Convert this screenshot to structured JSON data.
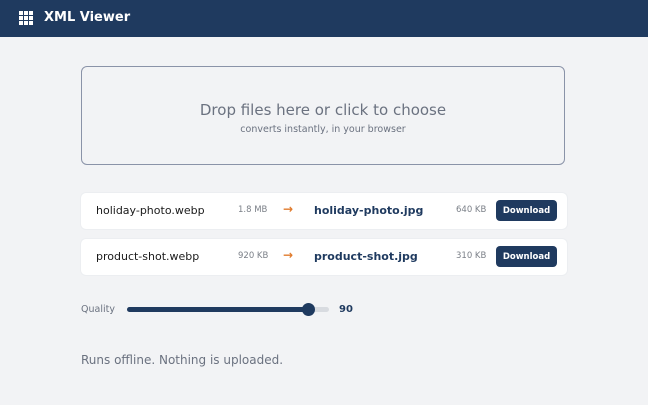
{
  "app": {
    "title": "XML Viewer",
    "icon": "grid-icon"
  },
  "dropzone": {
    "main_text": "Drop files here or click to choose",
    "sub_text": "converts instantly, in your browser"
  },
  "files": [
    {
      "source_name": "holiday-photo.webp",
      "source_size": "1.8 MB",
      "arrow": "→",
      "output_name": "holiday-photo.jpg",
      "output_size": "640 KB",
      "download_label": "Download"
    },
    {
      "source_name": "product-shot.webp",
      "source_size": "920 KB",
      "arrow": "→",
      "output_name": "product-shot.jpg",
      "output_size": "310 KB",
      "download_label": "Download"
    }
  ],
  "quality": {
    "label": "Quality",
    "value": "90",
    "level_fraction": 0.9
  },
  "footer": {
    "note": "Runs offline. Nothing is uploaded."
  },
  "colors": {
    "brand": "#1f3a5f",
    "accent": "#e07b2c",
    "background": "#f2f3f5"
  }
}
